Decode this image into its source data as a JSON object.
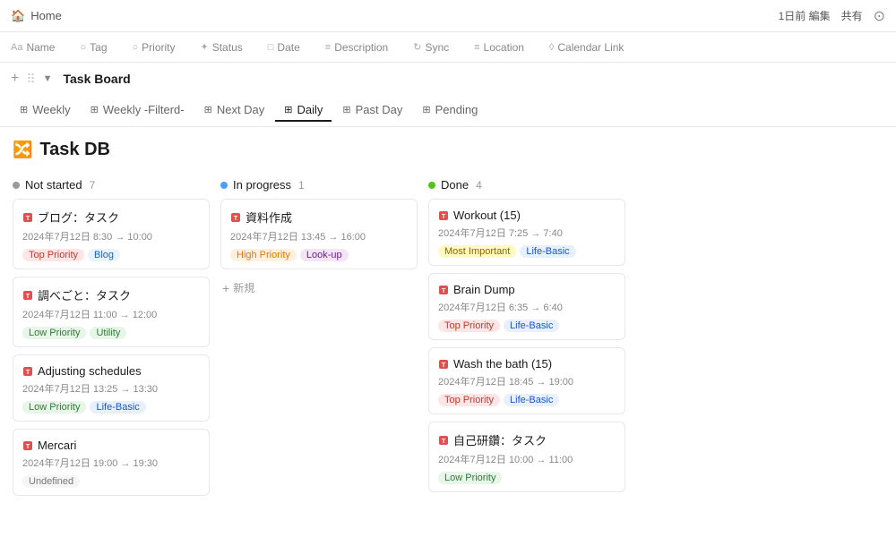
{
  "topbar": {
    "home_label": "Home",
    "right_actions": [
      "1日前 編集",
      "共有"
    ]
  },
  "colheaders": [
    {
      "icon": "Aa",
      "label": "Name"
    },
    {
      "icon": "○",
      "label": "Tag"
    },
    {
      "icon": "○",
      "label": "Priority"
    },
    {
      "icon": "✦",
      "label": "Status"
    },
    {
      "icon": "□",
      "label": "Date"
    },
    {
      "icon": "≡",
      "label": "Description"
    },
    {
      "icon": "↻",
      "label": "Sync"
    },
    {
      "icon": "≡",
      "label": "Location"
    },
    {
      "icon": "◊",
      "label": "Calendar Link"
    }
  ],
  "toolbar": {
    "add_icon": "+",
    "drag_icon": "⠿",
    "arrow_icon": "▼",
    "title": "Task Board"
  },
  "tabs": [
    {
      "icon": "⊞",
      "label": "Weekly",
      "active": false
    },
    {
      "icon": "⊞",
      "label": "Weekly -Filterd-",
      "active": false
    },
    {
      "icon": "⊞",
      "label": "Next Day",
      "active": false
    },
    {
      "icon": "⊞",
      "label": "Daily",
      "active": true
    },
    {
      "icon": "⊞",
      "label": "Past Day",
      "active": false
    },
    {
      "icon": "⊞",
      "label": "Pending",
      "active": false
    }
  ],
  "page": {
    "icon": "🔀",
    "title": "Task DB"
  },
  "board": {
    "columns": [
      {
        "id": "not-started",
        "dot_color": "#999",
        "title": "Not started",
        "count": 7,
        "cards": [
          {
            "title_icon": "🔴",
            "title": "ブログ：タスク",
            "date": "2024年7月12日 8:30 → 10:00",
            "tags": [
              {
                "label": "Top Priority",
                "class": "tag-top-priority"
              },
              {
                "label": "Blog",
                "class": "tag-blog"
              }
            ]
          },
          {
            "title_icon": "🔴",
            "title": "調べごと：タスク",
            "date": "2024年7月12日 11:00 → 12:00",
            "tags": [
              {
                "label": "Low Priority",
                "class": "tag-low-priority"
              },
              {
                "label": "Utility",
                "class": "tag-utility"
              }
            ]
          },
          {
            "title_icon": "🔴",
            "title": "Adjusting schedules",
            "date": "2024年7月12日 13:25 → 13:30",
            "tags": [
              {
                "label": "Low Priority",
                "class": "tag-low-priority"
              },
              {
                "label": "Life-Basic",
                "class": "tag-life-basic"
              }
            ]
          },
          {
            "title_icon": "🔴",
            "title": "Mercari",
            "date": "2024年7月12日 19:00 → 19:30",
            "tags": [
              {
                "label": "Undefined",
                "class": "tag-undefined"
              }
            ]
          }
        ]
      },
      {
        "id": "in-progress",
        "dot_color": "#4a9eff",
        "title": "In progress",
        "count": 1,
        "cards": [
          {
            "title_icon": "🔴",
            "title": "資料作成",
            "date": "2024年7月12日 13:45 → 16:00",
            "tags": [
              {
                "label": "High Priority",
                "class": "tag-high-priority"
              },
              {
                "label": "Look-up",
                "class": "tag-look-up"
              }
            ]
          }
        ],
        "add_label": "新規"
      },
      {
        "id": "done",
        "dot_color": "#52c41a",
        "title": "Done",
        "count": 4,
        "cards": [
          {
            "title_icon": "🔴",
            "title": "Workout (15)",
            "date": "2024年7月12日 7:25 → 7:40",
            "tags": [
              {
                "label": "Most Important",
                "class": "tag-most-important"
              },
              {
                "label": "Life-Basic",
                "class": "tag-life-basic"
              }
            ]
          },
          {
            "title_icon": "🔴",
            "title": "Brain Dump",
            "date": "2024年7月12日 6:35 → 6:40",
            "tags": [
              {
                "label": "Top Priority",
                "class": "tag-top-priority"
              },
              {
                "label": "Life-Basic",
                "class": "tag-life-basic"
              }
            ]
          },
          {
            "title_icon": "🔴",
            "title": "Wash the bath (15)",
            "date": "2024年7月12日 18:45 → 19:00",
            "tags": [
              {
                "label": "Top Priority",
                "class": "tag-top-priority"
              },
              {
                "label": "Life-Basic",
                "class": "tag-life-basic"
              }
            ]
          },
          {
            "title_icon": "🔴",
            "title": "自己研鑽：タスク",
            "date": "2024年7月12日 10:00 → 11:00",
            "tags": [
              {
                "label": "Low Priority",
                "class": "tag-low-priority"
              }
            ]
          }
        ]
      }
    ]
  }
}
